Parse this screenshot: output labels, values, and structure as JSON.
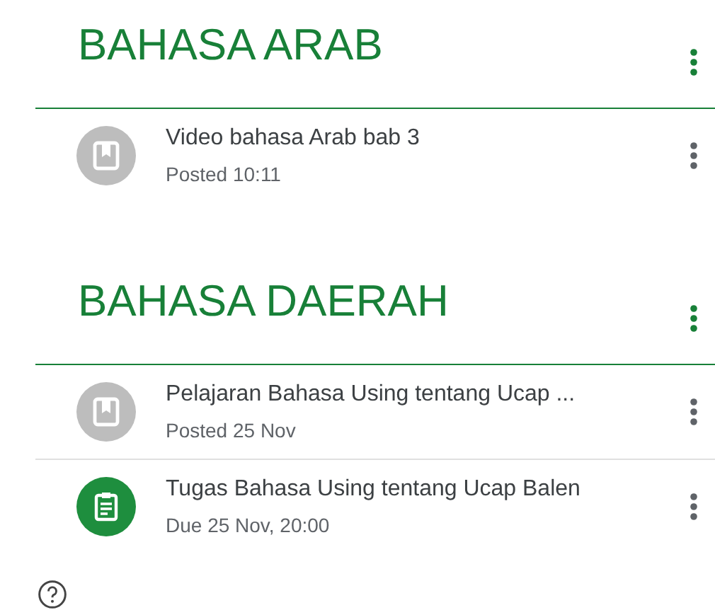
{
  "sections": [
    {
      "title": "BAHASA ARAB",
      "items": [
        {
          "kind": "material",
          "title": "Video bahasa Arab bab 3",
          "subtitle": "Posted 10:11"
        }
      ]
    },
    {
      "title": "BAHASA DAERAH",
      "items": [
        {
          "kind": "material",
          "title": "Pelajaran Bahasa Using tentang Ucap ...",
          "subtitle": "Posted 25 Nov"
        },
        {
          "kind": "assignment",
          "title": "Tugas Bahasa Using tentang Ucap Balen",
          "subtitle": "Due 25 Nov, 20:00"
        }
      ]
    }
  ]
}
